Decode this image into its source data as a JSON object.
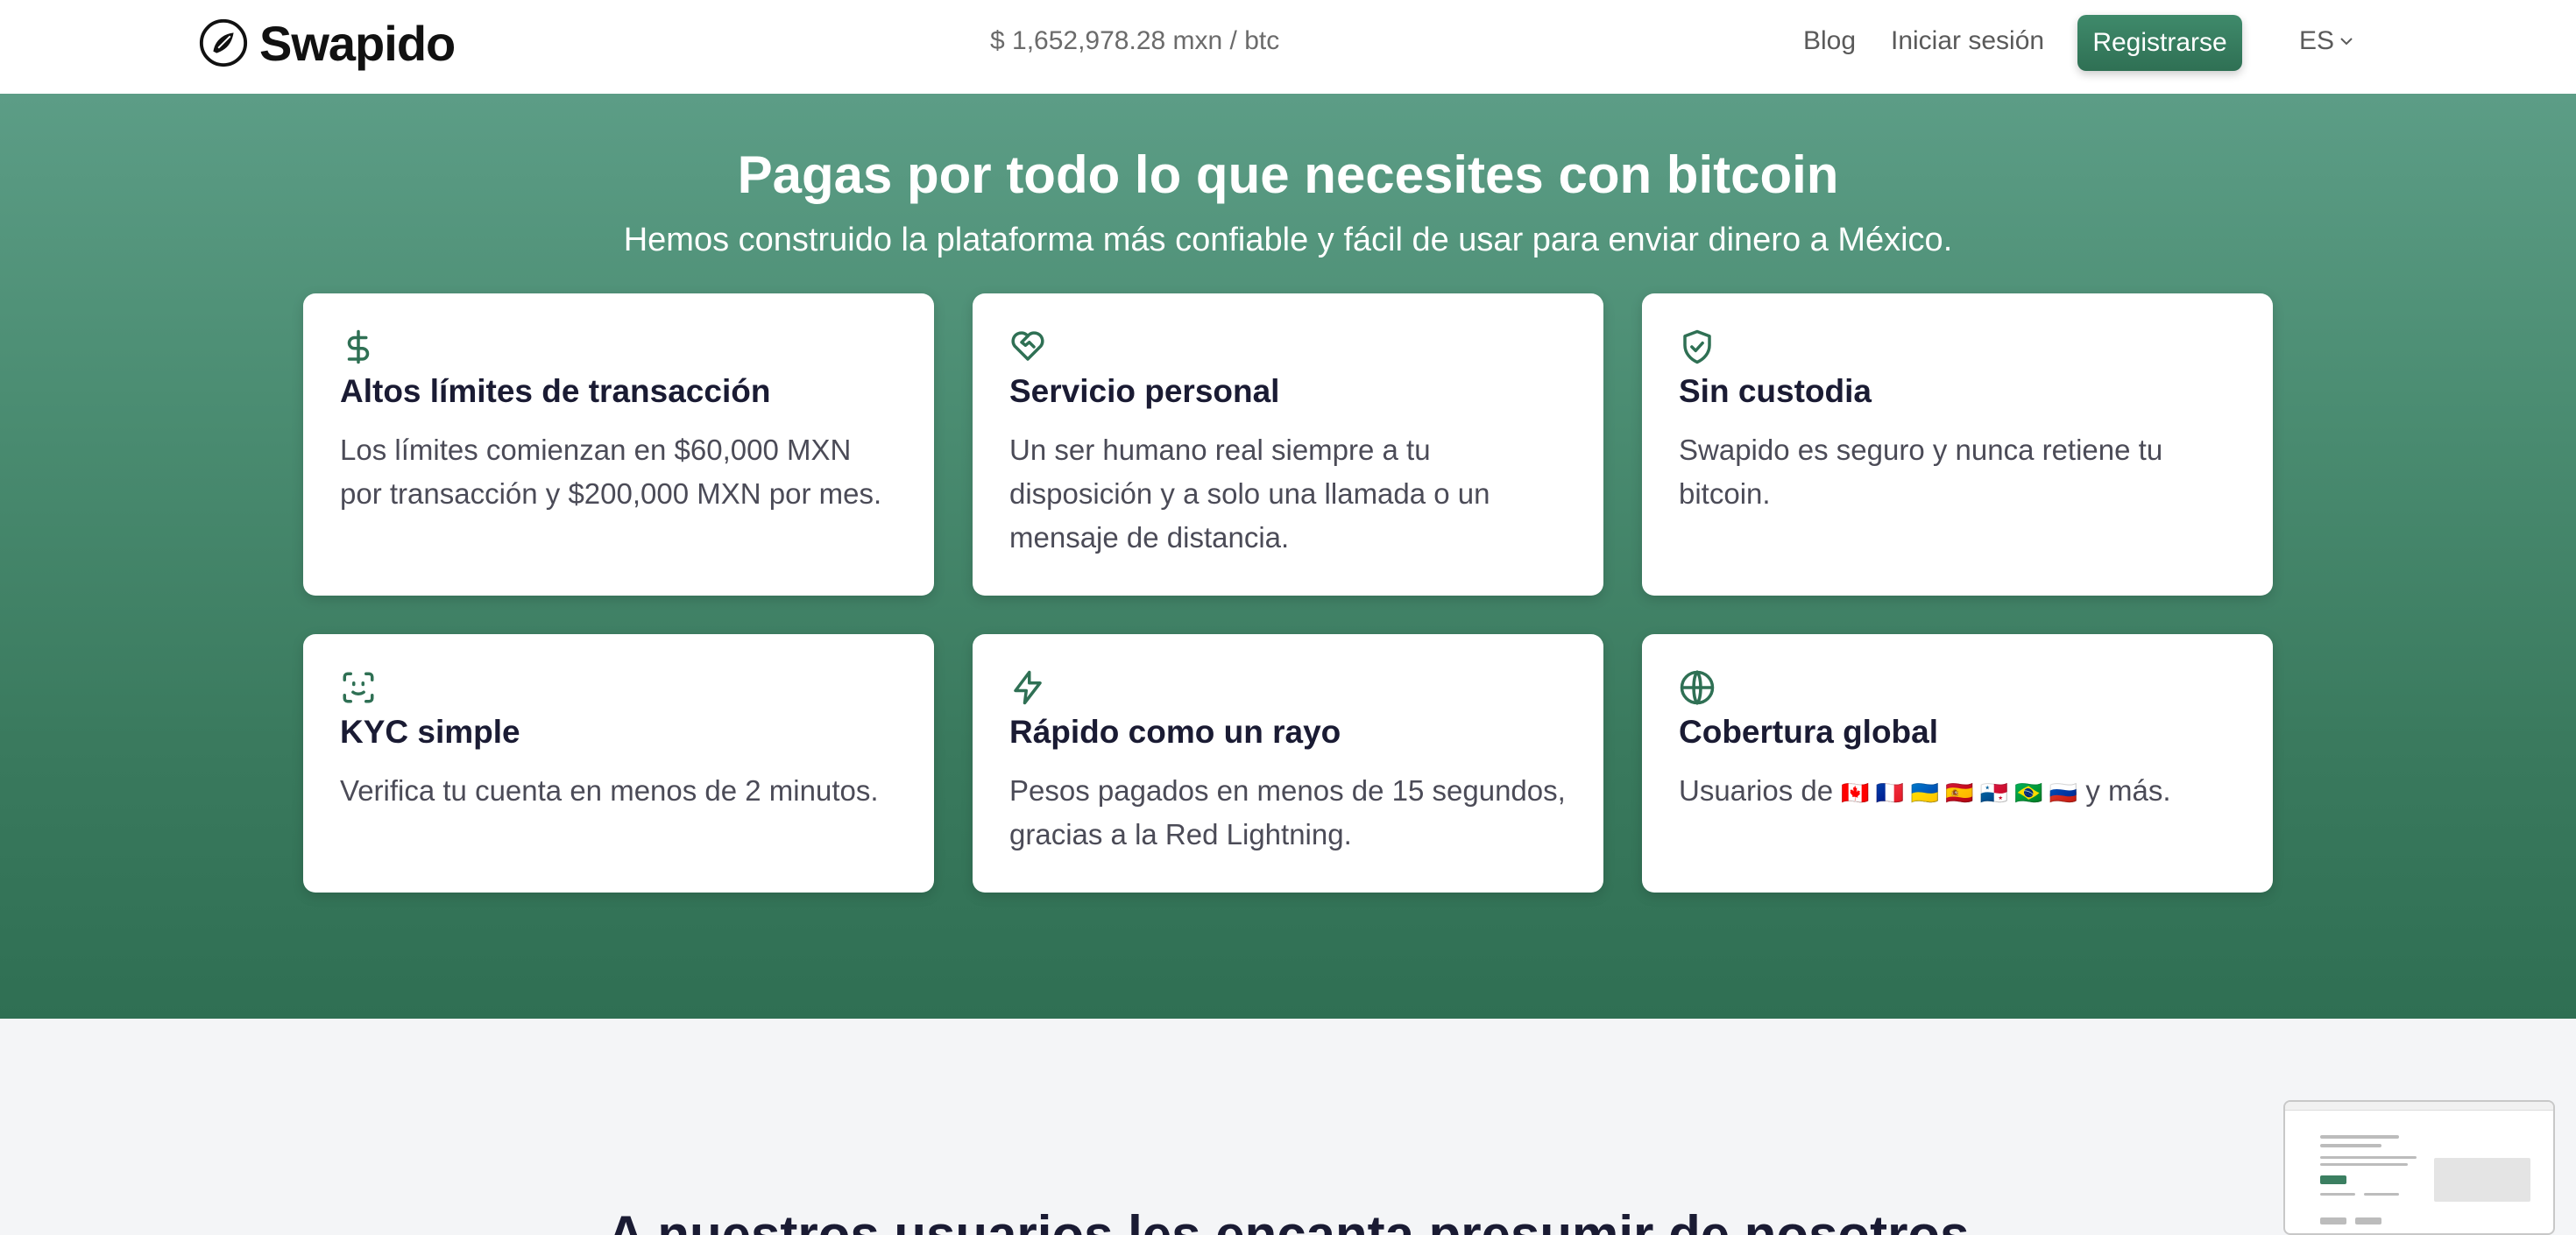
{
  "header": {
    "brand": "Swapido",
    "price": "$ 1,652,978.28 mxn / btc",
    "nav": {
      "blog": "Blog",
      "login": "Iniciar sesión",
      "register": "Registrarse",
      "language": "ES"
    }
  },
  "hero": {
    "title": "Pagas por todo lo que necesites con bitcoin",
    "subtitle": "Hemos construido la plataforma más confiable y fácil de usar para enviar dinero a México.",
    "cards": [
      {
        "icon": "dollar-icon",
        "title": "Altos límites de transacción",
        "text": "Los límites comienzan en $60,000 MXN por transacción y $200,000 MXN por mes."
      },
      {
        "icon": "heart-handshake-icon",
        "title": "Servicio personal",
        "text": "Un ser humano real siempre a tu disposición y a solo una llamada o un mensaje de distancia."
      },
      {
        "icon": "shield-check-icon",
        "title": "Sin custodia",
        "text": "Swapido es seguro y nunca retiene tu bitcoin."
      },
      {
        "icon": "face-scan-icon",
        "title": "KYC simple",
        "text": "Verifica tu cuenta en menos de 2 minutos."
      },
      {
        "icon": "lightning-icon",
        "title": "Rápido como un rayo",
        "text": "Pesos pagados en menos de 15 segundos, gracias a la Red Lightning."
      },
      {
        "icon": "globe-icon",
        "title": "Cobertura global",
        "text_prefix": "Usuarios de",
        "flags": "🇨🇦 🇫🇷 🇺🇦 🇪🇸 🇵🇦 🇧🇷 🇷🇺",
        "text_suffix": "y más."
      }
    ]
  },
  "lower": {
    "title": "A nuestros usuarios les encanta presumir de nosotros"
  },
  "colors": {
    "accent": "#2f7054",
    "hero_top": "#5c9d86",
    "hero_bottom": "#2f6f53"
  }
}
